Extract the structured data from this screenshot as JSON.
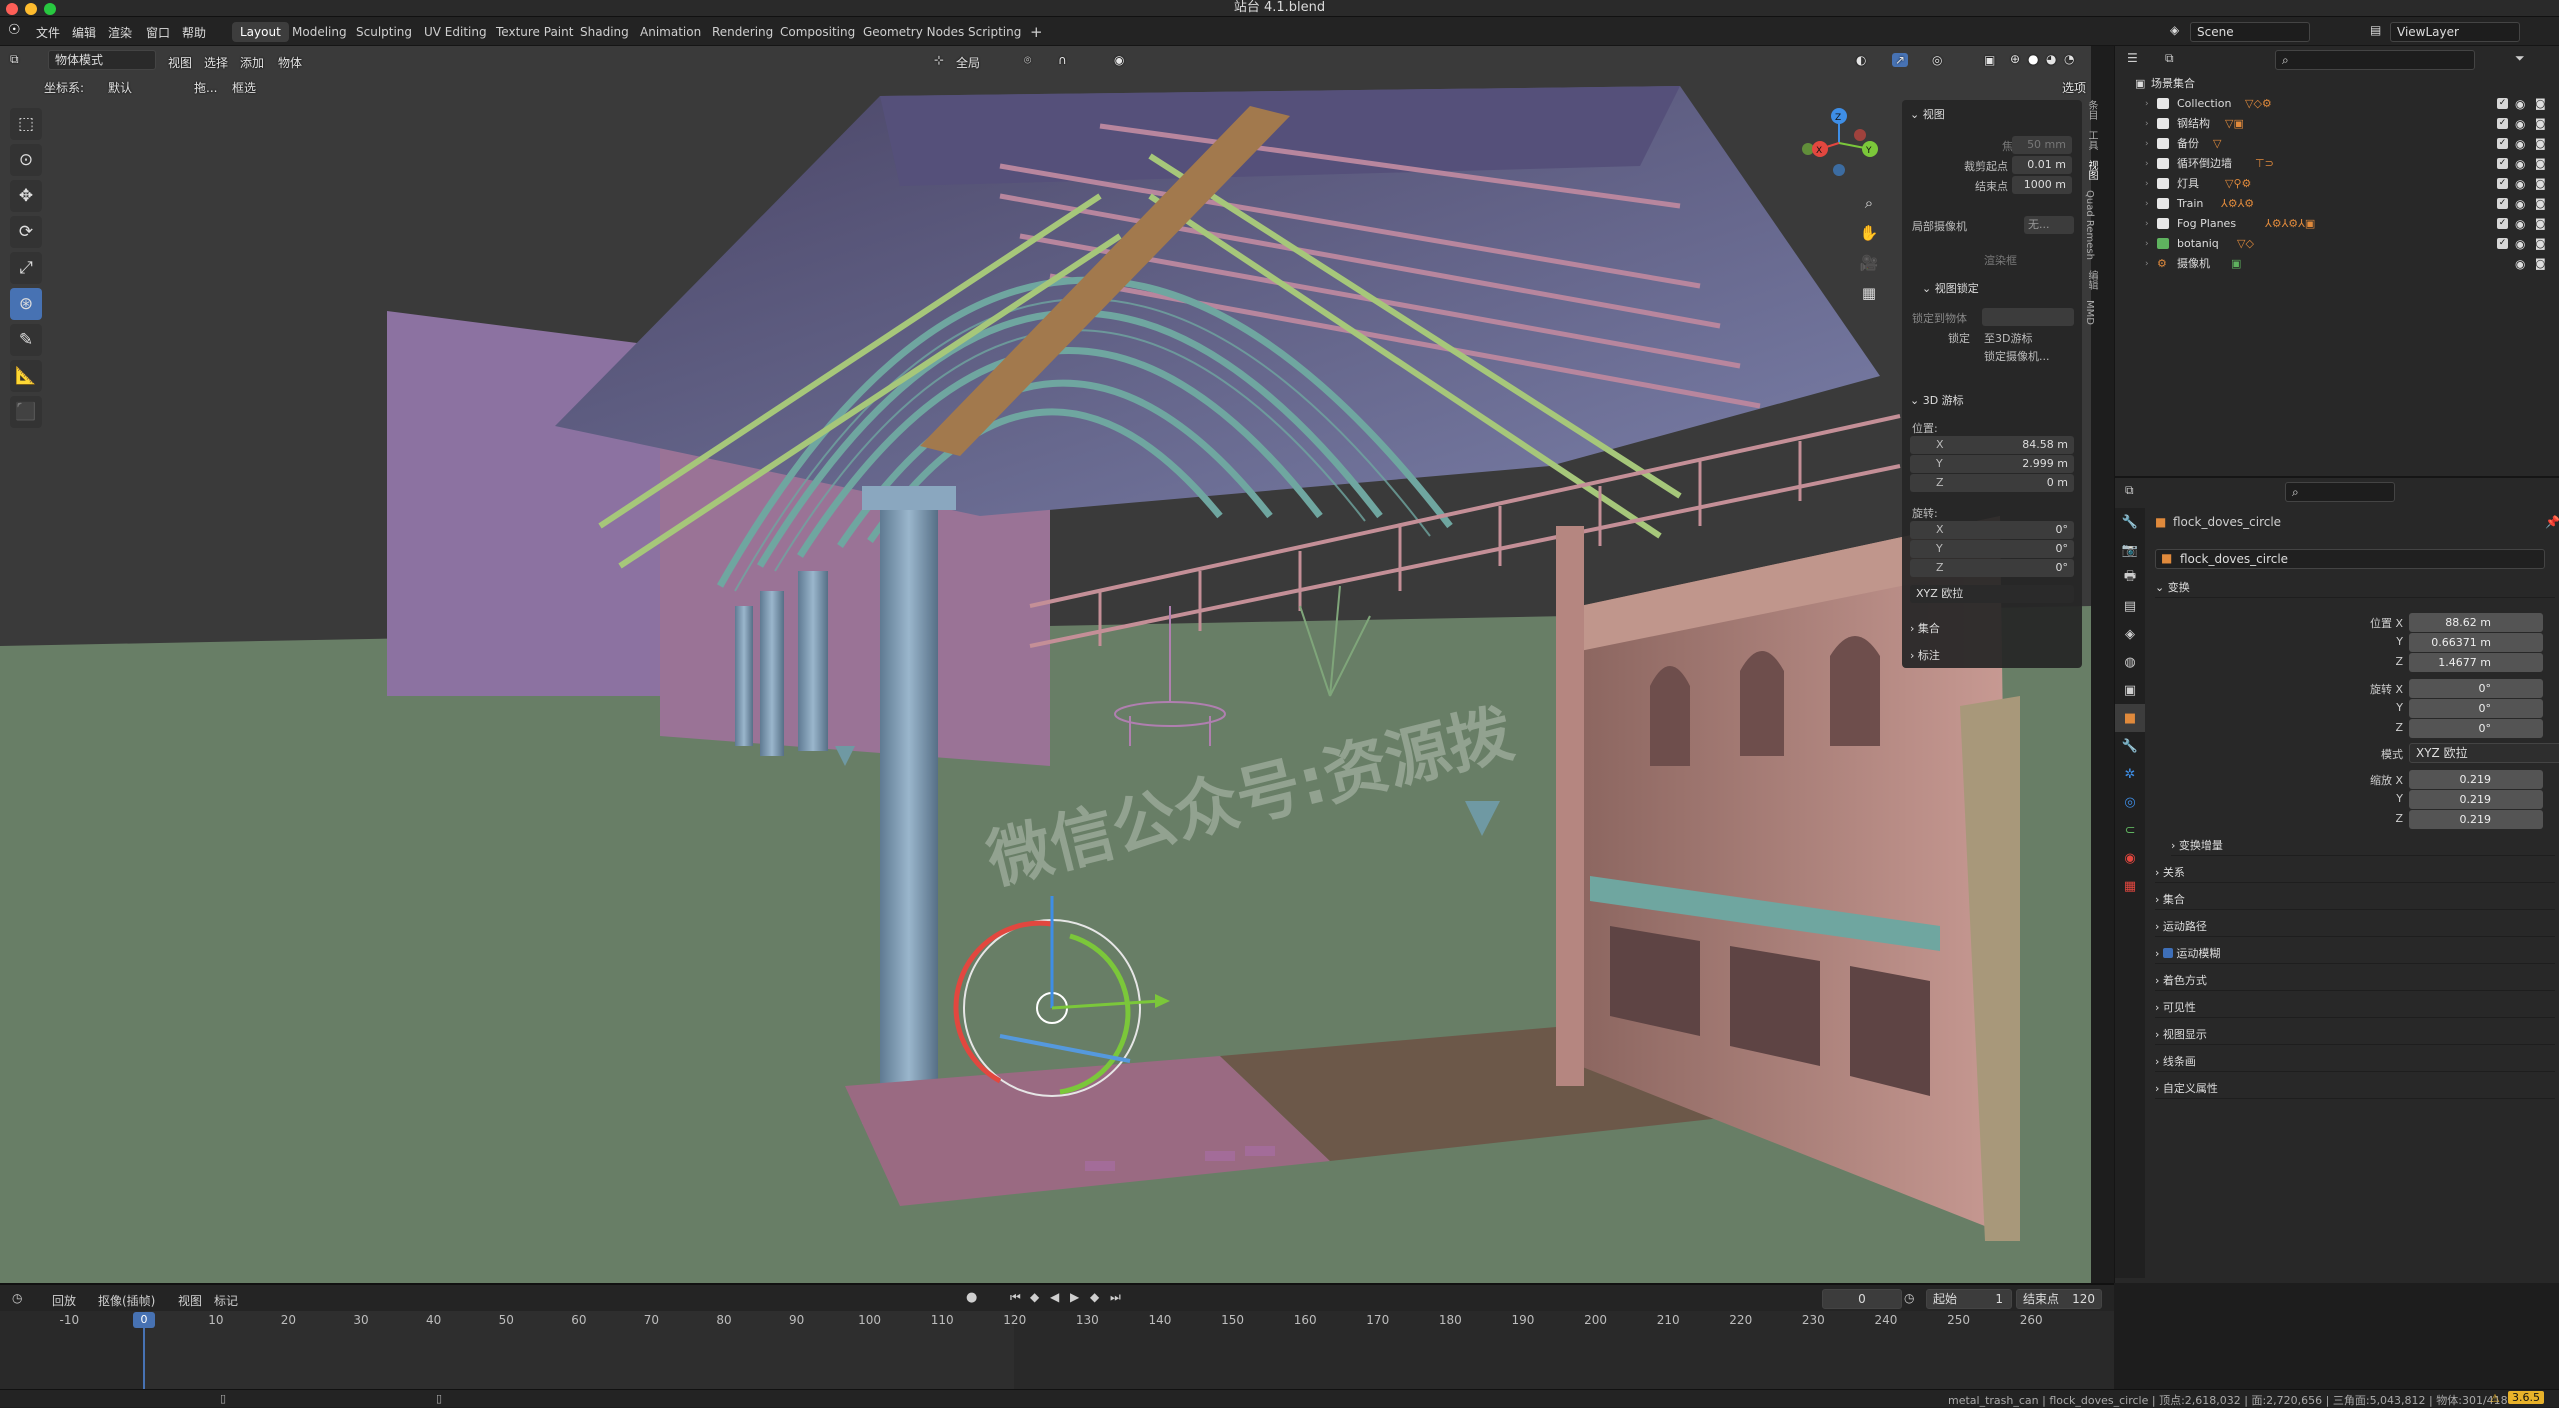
{
  "window": {
    "title": "站台 4.1.blend"
  },
  "topbar": {
    "menus": [
      "文件",
      "编辑",
      "渲染",
      "窗口",
      "帮助"
    ],
    "workspaces": [
      "Layout",
      "Modeling",
      "Sculpting",
      "UV Editing",
      "Texture Paint",
      "Shading",
      "Animation",
      "Rendering",
      "Compositing",
      "Geometry Nodes",
      "Scripting"
    ],
    "active_workspace": "Layout",
    "add_tab": "+",
    "scene": "Scene",
    "view_layer": "ViewLayer"
  },
  "viewport_header": {
    "mode": "物体模式",
    "menus": [
      "视图",
      "选择",
      "添加",
      "物体"
    ],
    "transform_orientation_label": "坐标系:",
    "transform_orientation": "默认",
    "drag_label": "拖...",
    "select_mode": "框选",
    "pivot": "全局",
    "options": "选项"
  },
  "watermark": "微信公众号:资源拨",
  "npanel": {
    "tabs": [
      "条目",
      "工具",
      "视图",
      "Quad Remesh",
      "编辑",
      "MMD"
    ],
    "view_section": "视图",
    "focal_label": "焦距",
    "focal_value": "50 mm",
    "clip_start_label": "裁剪起点",
    "clip_start_value": "0.01 m",
    "clip_end_label": "结束点",
    "clip_end_value": "1000 m",
    "local_camera_label": "局部摄像机",
    "local_camera_value": "无...",
    "render_region_label": "渲染框",
    "view_lock_section": "视图锁定",
    "lock_to_object_label": "锁定到物体",
    "lock_label": "锁定",
    "lock_to_cursor": "至3D游标",
    "lock_camera": "锁定摄像机...",
    "cursor_section": "3D 游标",
    "location_label": "位置:",
    "loc_x": "84.58 m",
    "loc_y": "2.999 m",
    "loc_z": "0 m",
    "rotation_label": "旋转:",
    "rot_x": "0°",
    "rot_y": "0°",
    "rot_z": "0°",
    "rotation_mode": "XYZ 欧拉",
    "collection_section": "集合",
    "annotation_section": "标注"
  },
  "outliner": {
    "root": "场景集合",
    "items": [
      {
        "name": "Collection"
      },
      {
        "name": "钢结构"
      },
      {
        "name": "备份"
      },
      {
        "name": "循环倒边墙"
      },
      {
        "name": "灯具"
      },
      {
        "name": "Train"
      },
      {
        "name": "Fog Planes"
      },
      {
        "name": "botaniq"
      },
      {
        "name": "摄像机"
      }
    ]
  },
  "properties": {
    "object_name": "flock_doves_circle",
    "data_name": "flock_doves_circle",
    "transform_section": "变换",
    "location_x_label": "位置 X",
    "location_y_label": "Y",
    "location_z_label": "Z",
    "location": [
      "88.62 m",
      "0.66371 m",
      "1.4677 m"
    ],
    "rotation_x_label": "旋转 X",
    "rotation_y_label": "Y",
    "rotation_z_label": "Z",
    "rotation": [
      "0°",
      "0°",
      "0°"
    ],
    "mode_label": "模式",
    "mode_value": "XYZ 欧拉",
    "scale_x_label": "缩放 X",
    "scale_y_label": "Y",
    "scale_z_label": "Z",
    "scale": [
      "0.219",
      "0.219",
      "0.219"
    ],
    "delta_transform": "变换增量",
    "sections": [
      "关系",
      "集合",
      "运动路径",
      "运动模糊",
      "着色方式",
      "可见性",
      "视图显示",
      "线条画",
      "自定义属性"
    ]
  },
  "timeline": {
    "menus": [
      "回放",
      "抠像(插帧)",
      "视图",
      "标记"
    ],
    "current_frame": "0",
    "start_label": "起始",
    "start": "1",
    "end_label": "结束点",
    "end": "120",
    "ticks": [
      "-10",
      "0",
      "10",
      "20",
      "30",
      "40",
      "50",
      "60",
      "70",
      "80",
      "90",
      "100",
      "110",
      "120",
      "130",
      "140",
      "150",
      "160",
      "170",
      "180",
      "190",
      "200",
      "210",
      "220",
      "230",
      "240",
      "250",
      "260"
    ]
  },
  "statusbar": {
    "info": "metal_trash_can | flock_doves_circle | 顶点:2,618,032 | 面:2,720,656 | 三角面:5,043,812 | 物体:301/418",
    "version": "3.6.5"
  },
  "colors": {
    "accent": "#4772b3",
    "grass": "#687e66",
    "truss_teal": "#6fa6a0",
    "truss_lime": "#a6c77a",
    "column": "#7d99b0",
    "wall_pink": "#b58c88"
  }
}
